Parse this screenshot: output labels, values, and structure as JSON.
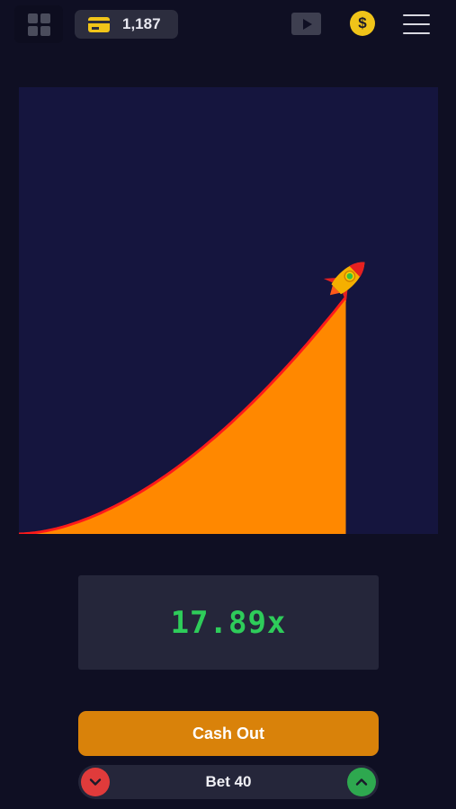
{
  "header": {
    "balance": "1,187",
    "coin_symbol": "$",
    "icons": {
      "grid": "grid-icon",
      "wallet": "credit-card-icon",
      "play": "play-icon",
      "coin": "dollar-coin-icon",
      "menu": "hamburger-menu-icon"
    }
  },
  "game": {
    "multiplier": "17.89x",
    "progress": 0.78,
    "colors": {
      "sky": "#15153e",
      "fill": "#ff8800",
      "curve": "#ff1a1a"
    },
    "rocket_icon": "rocket-icon"
  },
  "controls": {
    "cashout_label": "Cash Out",
    "bet_label": "Bet 40",
    "decrease_icon": "chevron-down-icon",
    "increase_icon": "chevron-up-icon"
  },
  "colors": {
    "background": "#0f0f23",
    "accent": "#d9820a",
    "multiplier": "#2ecc5a",
    "gold": "#f0c419"
  }
}
